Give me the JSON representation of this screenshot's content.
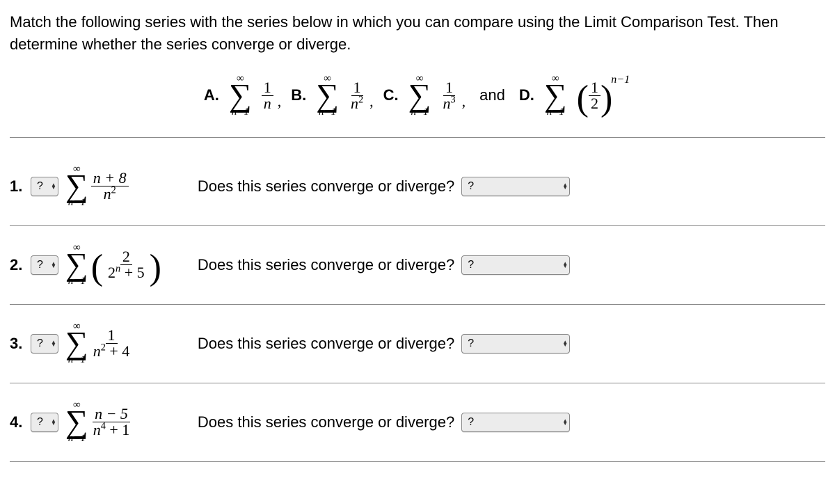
{
  "intro": "Match the following series with the series below in which you can compare using the Limit Comparison Test. Then determine whether the series converge or diverge.",
  "options": {
    "a_label": "A.",
    "a_frac_num": "1",
    "a_frac_den": "n",
    "b_label": "B.",
    "b_frac_num": "1",
    "b_frac_den_base": "n",
    "b_frac_den_exp": "2",
    "c_label": "C.",
    "c_frac_num": "1",
    "c_frac_den_base": "n",
    "c_frac_den_exp": "3",
    "and": "and",
    "d_label": "D.",
    "d_frac_num": "1",
    "d_frac_den": "2",
    "d_exp": "n−1",
    "sigma_top": "∞",
    "sigma_bot": "n=1",
    "comma": ","
  },
  "select_placeholder": "?",
  "question_text": "Does this series converge or diverge?",
  "questions": {
    "q1": {
      "num": "1.",
      "frac_num": "n + 8",
      "frac_den_base": "n",
      "frac_den_exp": "2"
    },
    "q2": {
      "num": "2.",
      "frac_num": "2",
      "frac_den_a": "2",
      "frac_den_exp": "n",
      "frac_den_b": " + 5"
    },
    "q3": {
      "num": "3.",
      "frac_num": "1",
      "frac_den_a": "n",
      "frac_den_exp": "2",
      "frac_den_b": " + 4"
    },
    "q4": {
      "num": "4.",
      "frac_num": "n − 5",
      "frac_den_a": "n",
      "frac_den_exp": "4",
      "frac_den_b": " + 1"
    }
  }
}
